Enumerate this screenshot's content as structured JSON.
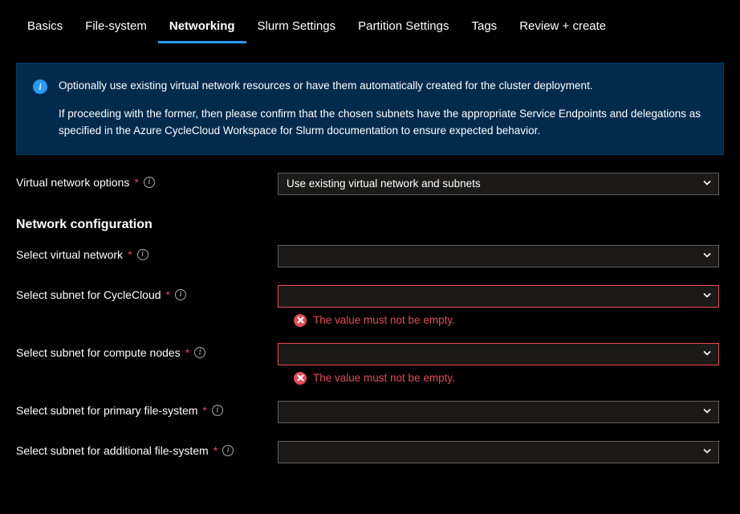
{
  "tabs": {
    "basics": "Basics",
    "file_system": "File-system",
    "networking": "Networking",
    "slurm_settings": "Slurm Settings",
    "partition_settings": "Partition Settings",
    "tags": "Tags",
    "review_create": "Review + create"
  },
  "info_box": {
    "line1": "Optionally use existing virtual network resources or have them automatically created for the cluster deployment.",
    "line2": "If proceeding with the former, then please confirm that the chosen subnets have the appropriate Service Endpoints and delegations as specified in the Azure CycleCloud Workspace for Slurm documentation to ensure expected behavior."
  },
  "fields": {
    "vnet_options": {
      "label": "Virtual network options",
      "value": "Use existing virtual network and subnets"
    },
    "section_heading": "Network configuration",
    "select_vnet": {
      "label": "Select virtual network",
      "value": ""
    },
    "select_subnet_cyclecloud": {
      "label": "Select subnet for CycleCloud",
      "value": "",
      "error": "The value must not be empty."
    },
    "select_subnet_compute": {
      "label": "Select subnet for compute nodes",
      "value": "",
      "error": "The value must not be empty."
    },
    "select_subnet_primary_fs": {
      "label": "Select subnet for primary file-system",
      "value": ""
    },
    "select_subnet_additional_fs": {
      "label": "Select subnet for additional file-system",
      "value": ""
    }
  },
  "required_marker": "*"
}
